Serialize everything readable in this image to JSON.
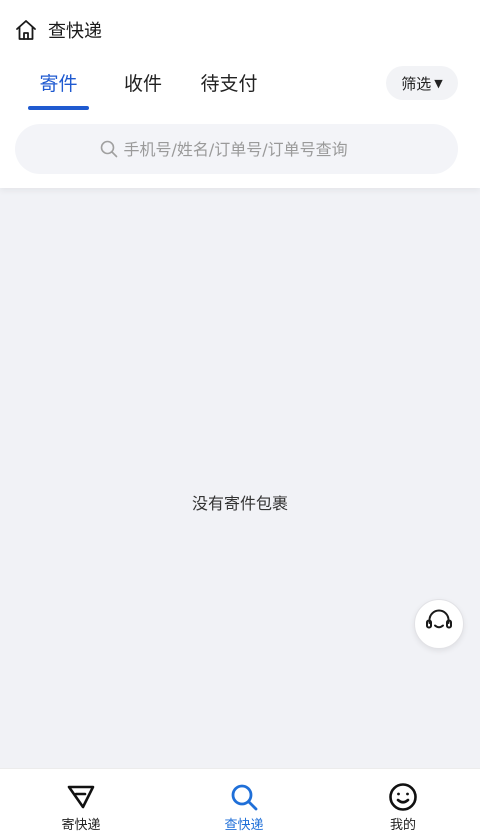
{
  "header": {
    "title": "查快递"
  },
  "tabs": [
    {
      "label": "寄件",
      "active": true
    },
    {
      "label": "收件",
      "active": false
    },
    {
      "label": "待支付",
      "active": false
    }
  ],
  "filter": {
    "label": "筛选",
    "caret": "▼"
  },
  "search": {
    "placeholder": "手机号/姓名/订单号/订单号查询",
    "value": ""
  },
  "content": {
    "empty_text": "没有寄件包裹"
  },
  "bottom_nav": [
    {
      "label": "寄快递",
      "icon": "send-icon",
      "active": false
    },
    {
      "label": "查快递",
      "icon": "search-icon",
      "active": true
    },
    {
      "label": "我的",
      "icon": "smiley-icon",
      "active": false
    }
  ],
  "colors": {
    "accent": "#1f5ad0",
    "nav_active": "#1f6fd8",
    "background": "#f1f2f6"
  }
}
